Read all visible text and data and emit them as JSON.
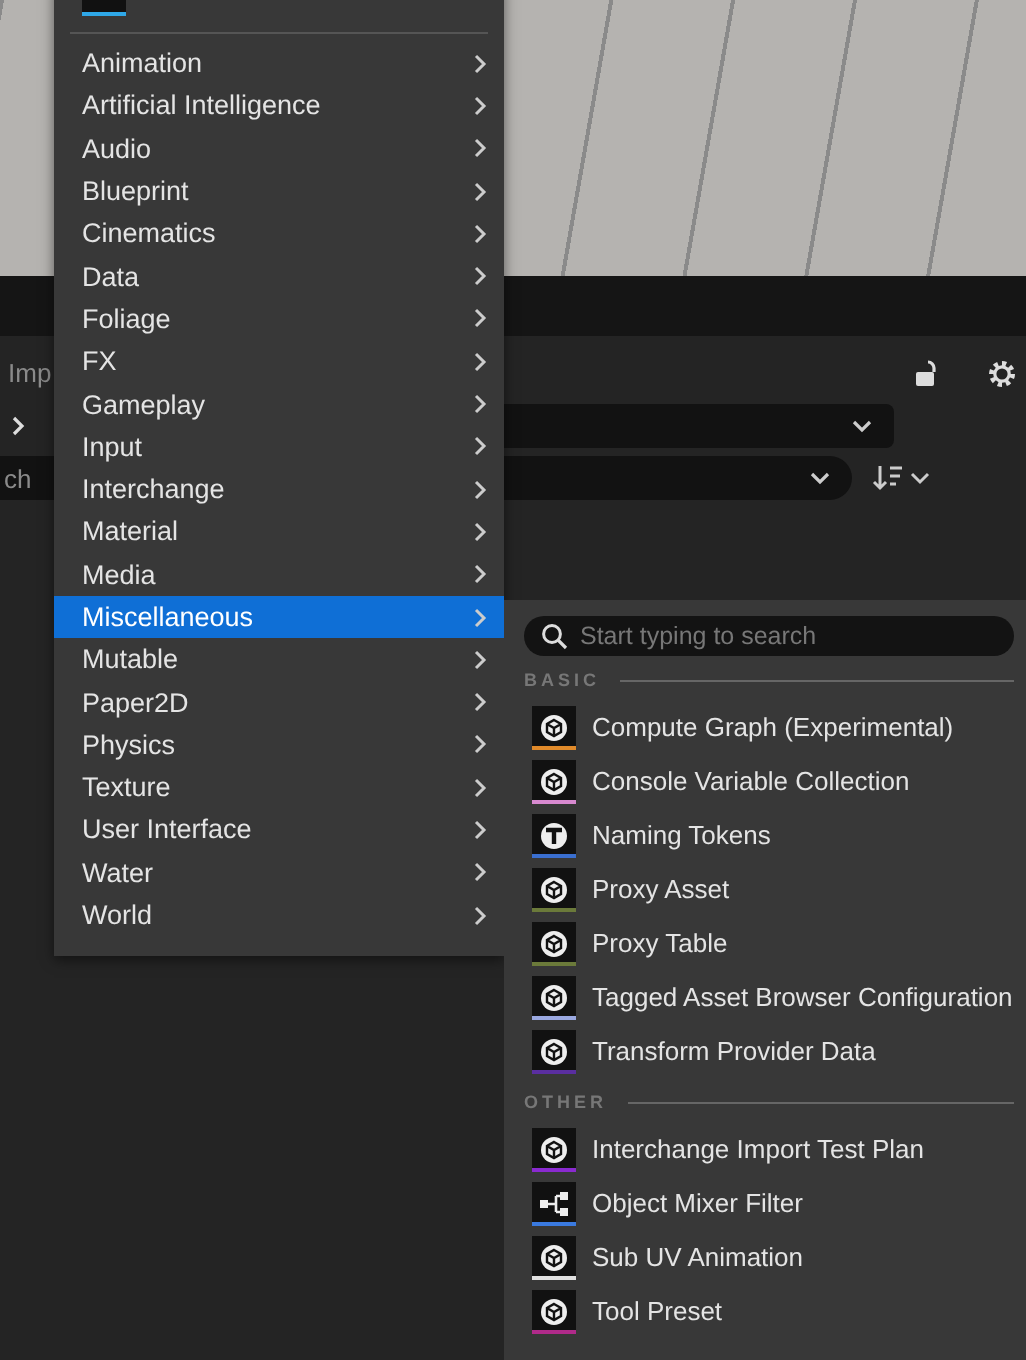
{
  "background": {
    "tab_fragment": "Imp",
    "search_fragment": "ch"
  },
  "menu": {
    "items": [
      {
        "label": "Animation",
        "selected": false
      },
      {
        "label": "Artificial Intelligence",
        "selected": false
      },
      {
        "label": "Audio",
        "selected": false
      },
      {
        "label": "Blueprint",
        "selected": false
      },
      {
        "label": "Cinematics",
        "selected": false
      },
      {
        "label": "Data",
        "selected": false
      },
      {
        "label": "Foliage",
        "selected": false
      },
      {
        "label": "FX",
        "selected": false
      },
      {
        "label": "Gameplay",
        "selected": false
      },
      {
        "label": "Input",
        "selected": false
      },
      {
        "label": "Interchange",
        "selected": false
      },
      {
        "label": "Material",
        "selected": false
      },
      {
        "label": "Media",
        "selected": false
      },
      {
        "label": "Miscellaneous",
        "selected": true
      },
      {
        "label": "Mutable",
        "selected": false
      },
      {
        "label": "Paper2D",
        "selected": false
      },
      {
        "label": "Physics",
        "selected": false
      },
      {
        "label": "Texture",
        "selected": false
      },
      {
        "label": "User Interface",
        "selected": false
      },
      {
        "label": "Water",
        "selected": false
      },
      {
        "label": "World",
        "selected": false
      }
    ]
  },
  "submenu": {
    "search": {
      "placeholder": "Start typing to search"
    },
    "sections": [
      {
        "heading": "BASIC",
        "items": [
          {
            "label": "Compute Graph (Experimental)",
            "kind": "cube",
            "color": "#e08a2a"
          },
          {
            "label": "Console Variable Collection",
            "kind": "cube",
            "color": "#d88ad0"
          },
          {
            "label": "Naming Tokens",
            "kind": "tokens",
            "color": "#3a6fd0"
          },
          {
            "label": "Proxy Asset",
            "kind": "cube",
            "color": "#6b7a3a"
          },
          {
            "label": "Proxy Table",
            "kind": "cube",
            "color": "#6b7a3a"
          },
          {
            "label": "Tagged Asset Browser Configuration",
            "kind": "cube",
            "color": "#9aa8e0"
          },
          {
            "label": "Transform Provider Data",
            "kind": "cube",
            "color": "#5a2ea0"
          }
        ]
      },
      {
        "heading": "OTHER",
        "items": [
          {
            "label": "Interchange Import Test Plan",
            "kind": "cube",
            "color": "#8a2ad0"
          },
          {
            "label": "Object Mixer Filter",
            "kind": "mixer",
            "color": "#3a7ae0"
          },
          {
            "label": "Sub UV Animation",
            "kind": "cube",
            "color": "#e0e0e0"
          },
          {
            "label": "Tool Preset",
            "kind": "cube",
            "color": "#b02a8a"
          }
        ]
      }
    ]
  }
}
